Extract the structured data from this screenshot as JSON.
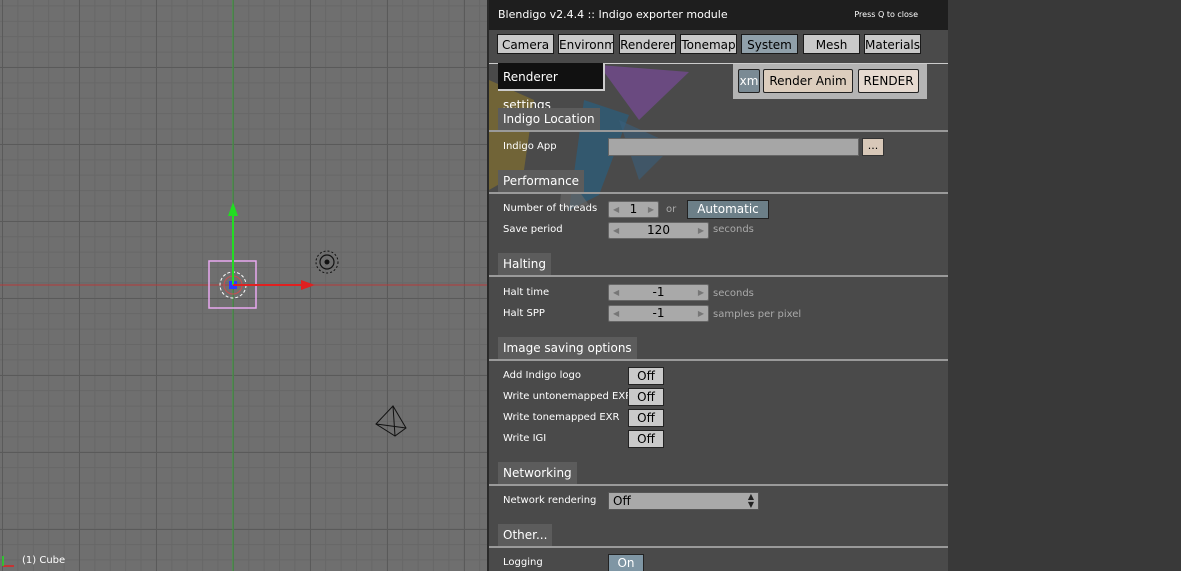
{
  "viewport": {
    "object_label": "(1) Cube"
  },
  "panel": {
    "title": "Blendigo  v2.4.4  ::  Indigo exporter module",
    "close_hint": "Press Q to close",
    "tabs": [
      {
        "label": "Camera"
      },
      {
        "label": "Environm"
      },
      {
        "label": "Renderer"
      },
      {
        "label": "Tonemap"
      },
      {
        "label": "System"
      },
      {
        "label": "Mesh"
      },
      {
        "label": "Materials"
      }
    ],
    "selected_tab": "System",
    "subheader": "Renderer settings",
    "buttons": {
      "xm": "xm",
      "render_anim": "Render Anim",
      "render": "RENDER"
    },
    "sections": {
      "location": {
        "title": "Indigo Location",
        "app_label": "Indigo App",
        "app_value": "",
        "browse": "..."
      },
      "performance": {
        "title": "Performance",
        "threads_label": "Number of threads",
        "threads_value": "1",
        "or_text": "or",
        "automatic": "Automatic",
        "save_label": "Save period",
        "save_value": "120",
        "save_unit": "seconds"
      },
      "halting": {
        "title": "Halting",
        "halt_time_label": "Halt time",
        "halt_time_value": "-1",
        "halt_time_unit": "seconds",
        "halt_spp_label": "Halt SPP",
        "halt_spp_value": "-1",
        "halt_spp_unit": "samples per pixel"
      },
      "image_saving": {
        "title": "Image saving options",
        "items": [
          {
            "label": "Add Indigo logo",
            "value": "Off"
          },
          {
            "label": "Write untonemapped EXR",
            "value": "Off"
          },
          {
            "label": "Write tonemapped EXR",
            "value": "Off"
          },
          {
            "label": "Write IGI",
            "value": "Off"
          }
        ]
      },
      "networking": {
        "title": "Networking",
        "label": "Network rendering",
        "value": "Off"
      },
      "other": {
        "title": "Other...",
        "logging_label": "Logging",
        "logging_value": "On"
      }
    }
  }
}
